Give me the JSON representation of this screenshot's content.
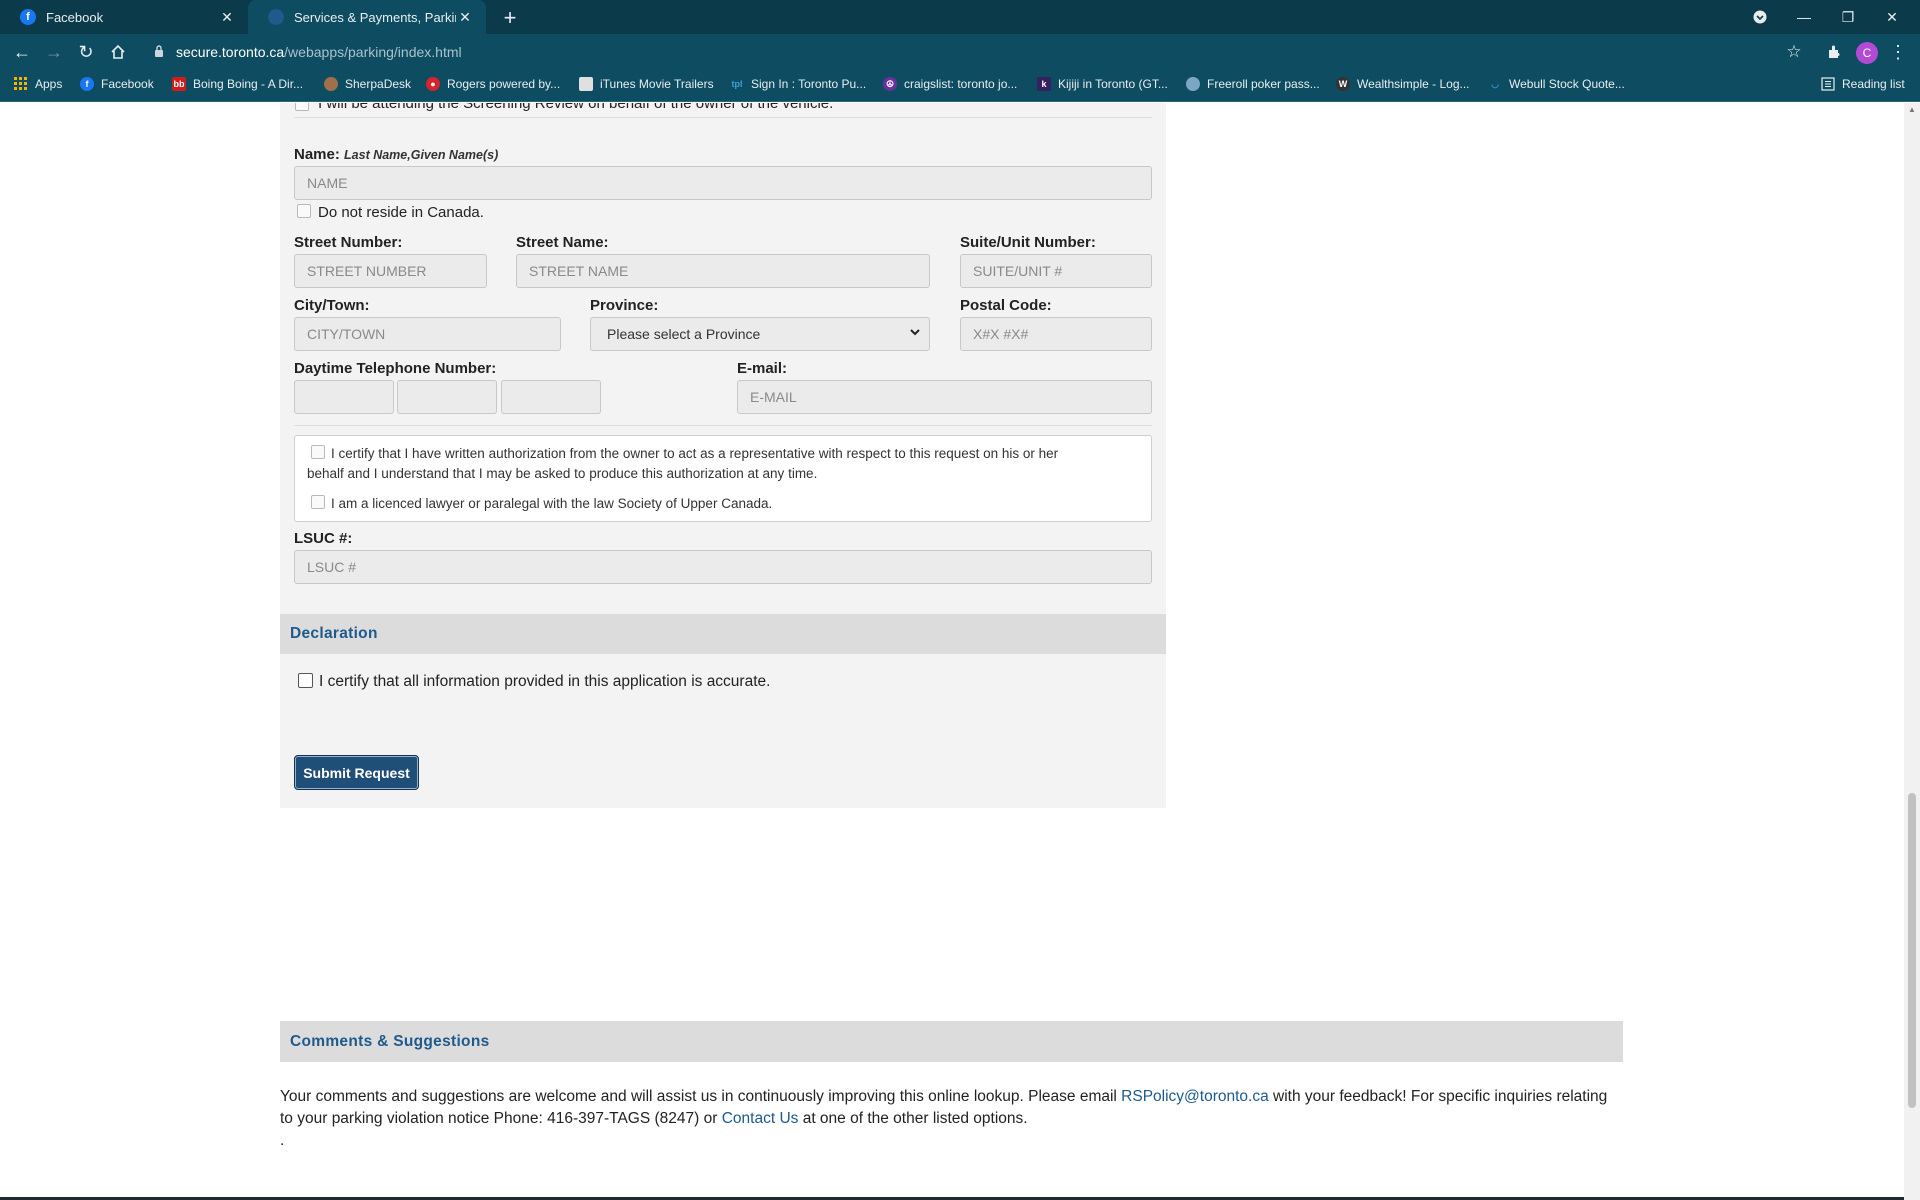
{
  "browser": {
    "tabs": [
      {
        "label": "Facebook",
        "icon": "facebook-icon",
        "active": false
      },
      {
        "label": "Services & Payments, Parking Vio",
        "icon": "toronto-site-icon",
        "active": true
      }
    ],
    "new_tab": "+",
    "url_host": "secure.toronto.ca",
    "url_path": "/webapps/parking/index.html",
    "profile_initial": "C",
    "bookmarks": [
      {
        "label": "Apps",
        "icon": "apps-grid-icon"
      },
      {
        "label": "Facebook",
        "icon": "facebook-icon"
      },
      {
        "label": "Boing Boing - A Dir...",
        "icon": "boingboing-icon"
      },
      {
        "label": "SherpaDesk",
        "icon": "sherpadesk-icon"
      },
      {
        "label": "Rogers powered by...",
        "icon": "rogers-icon"
      },
      {
        "label": "iTunes Movie Trailers",
        "icon": "itunes-icon"
      },
      {
        "label": "Sign In : Toronto Pu...",
        "icon": "tpl-icon"
      },
      {
        "label": "craigslist: toronto jo...",
        "icon": "peace-icon"
      },
      {
        "label": "Kijiji in Toronto (GT...",
        "icon": "kijiji-icon"
      },
      {
        "label": "Freeroll poker pass...",
        "icon": "poker-icon"
      },
      {
        "label": "Wealthsimple - Log...",
        "icon": "wealthsimple-icon"
      },
      {
        "label": "Webull Stock Quote...",
        "icon": "webull-icon"
      }
    ],
    "reading_list": "Reading list"
  },
  "form": {
    "attending_text": "I will be attending the Screening Review on behalf of the owner of the vehicle.",
    "name_label": "Name:",
    "name_hint": "Last Name,Given Name(s)",
    "name_placeholder": "NAME",
    "not_canada": "Do not reside in Canada.",
    "street_number_label": "Street Number:",
    "street_number_placeholder": "STREET NUMBER",
    "street_name_label": "Street Name:",
    "street_name_placeholder": "STREET NAME",
    "suite_label": "Suite/Unit Number:",
    "suite_placeholder": "SUITE/UNIT #",
    "city_label": "City/Town:",
    "city_placeholder": "CITY/TOWN",
    "province_label": "Province:",
    "province_value": "Please select a Province",
    "postal_label": "Postal Code:",
    "postal_placeholder": "X#X #X#",
    "phone_label": "Daytime Telephone Number:",
    "email_label": "E-mail:",
    "email_placeholder": "E-MAIL",
    "cert_authorization_line1": "I certify that I have written authorization from the owner to act as a representative with respect to this request on his or her",
    "cert_authorization_line2": "behalf and I understand that I may be asked to produce this authorization at any time.",
    "cert_lawyer": "I am a licenced lawyer or paralegal with the law Society of Upper Canada.",
    "lsuc_label": "LSUC #:",
    "lsuc_placeholder": "LSUC #"
  },
  "declaration": {
    "heading": "Declaration",
    "certify": "I certify that all information provided in this application is accurate.",
    "submit": "Submit Request"
  },
  "comments": {
    "heading": "Comments & Suggestions",
    "text1": "Your comments and suggestions are welcome and will assist us in continuously improving this online lookup. Please email ",
    "email_link": "RSPolicy@toronto.ca",
    "text2": " with your feedback! For specific inquiries relating to your parking violation notice Phone: 416-397-TAGS (8247) or ",
    "contact_link": "Contact Us",
    "text3": " at one of the other listed options.",
    "trailing": "."
  },
  "colors": {
    "chrome_dark": "#0b3a4a",
    "chrome": "#0e4c61",
    "link": "#1f5a8c",
    "button": "#1f4e79",
    "section_header": "#dcdcdc"
  }
}
